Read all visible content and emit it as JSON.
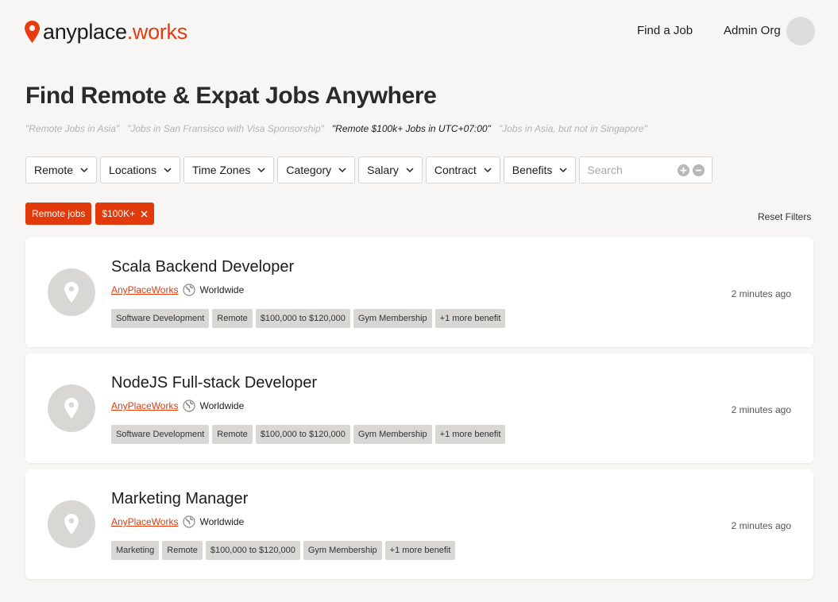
{
  "header": {
    "logo_main": "anyplace",
    "logo_dot": ".",
    "logo_accent": "works",
    "nav_find": "Find a Job",
    "nav_org": "Admin Org"
  },
  "page": {
    "title": "Find Remote & Expat Jobs Anywhere",
    "suggestions": [
      "\"Remote Jobs in Asia\"",
      "\"Jobs in San Fransisco with Visa Sponsorship\"",
      "\"Remote $100k+ Jobs in UTC+07:00\"",
      "\"Jobs in Asia, but not in Singapore\""
    ]
  },
  "filters": {
    "items": [
      "Remote",
      "Locations",
      "Time Zones",
      "Category",
      "Salary",
      "Contract",
      "Benefits"
    ],
    "search_placeholder": "Search"
  },
  "active_tags": [
    "Remote jobs",
    "$100K+"
  ],
  "reset_label": "Reset Filters",
  "jobs": [
    {
      "title": "Scala Backend Developer",
      "company": "AnyPlaceWorks",
      "location": "Worldwide",
      "tags": [
        "Software Development",
        "Remote",
        "$100,000 to $120,000",
        "Gym Membership",
        "+1 more benefit"
      ],
      "posted": "2 minutes ago"
    },
    {
      "title": "NodeJS Full-stack Developer",
      "company": "AnyPlaceWorks",
      "location": "Worldwide",
      "tags": [
        "Software Development",
        "Remote",
        "$100,000 to $120,000",
        "Gym Membership",
        "+1 more benefit"
      ],
      "posted": "2 minutes ago"
    },
    {
      "title": "Marketing Manager",
      "company": "AnyPlaceWorks",
      "location": "Worldwide",
      "tags": [
        "Marketing",
        "Remote",
        "$100,000 to $120,000",
        "Gym Membership",
        "+1 more benefit"
      ],
      "posted": "2 minutes ago"
    }
  ],
  "colors": {
    "accent": "#e23a0b",
    "background": "#f7f6f4",
    "tag_bg": "#d8d7d4"
  }
}
